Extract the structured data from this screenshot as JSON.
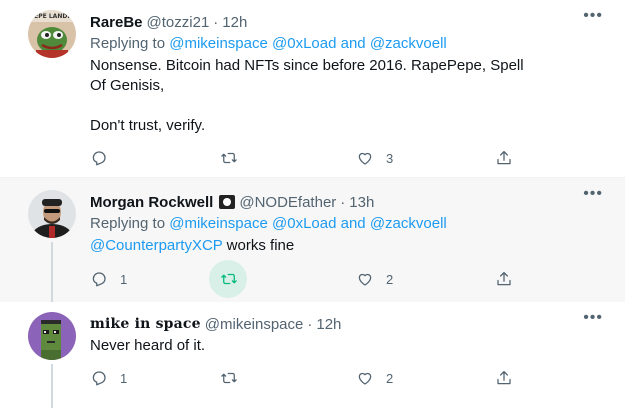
{
  "tweets": [
    {
      "name": "RareBe",
      "handle": "@tozzi21",
      "dot": "·",
      "time": "12h",
      "replying_prefix": "Replying to ",
      "replying_to": [
        "@mikeinspace",
        "@0xLoad",
        "@zackvoell"
      ],
      "replying_sep1": " ",
      "replying_and": " and ",
      "body_line1": "Nonsense. Bitcoin had NFTs since before 2016. RapePepe, Spell Of Genisis,",
      "body_line2": "Don't trust, verify.",
      "reply_count": "",
      "retweet_count": "",
      "like_count": "3",
      "avatar_label": "PEPE LANDIA"
    },
    {
      "name": "Morgan Rockwell",
      "handle": "@NODEfather",
      "dot": "·",
      "time": "13h",
      "replying_prefix": "Replying to ",
      "replying_to": [
        "@mikeinspace",
        "@0xLoad",
        "@zackvoell"
      ],
      "replying_sep1": " ",
      "replying_and": " and ",
      "body_mention": "@CounterpartyXCP",
      "body_rest": " works fine",
      "reply_count": "1",
      "retweet_count": "",
      "like_count": "2"
    },
    {
      "name": "mike in space",
      "handle": "@mikeinspace",
      "dot": "·",
      "time": "12h",
      "body": "Never heard of it.",
      "reply_count": "1",
      "retweet_count": "",
      "like_count": "2"
    }
  ],
  "icons": {
    "more": "more-icon",
    "reply": "reply-icon",
    "retweet": "retweet-icon",
    "like": "heart-icon",
    "share": "share-icon",
    "badge": "pirate-flag-icon"
  },
  "colors": {
    "link": "#1d9bf0",
    "muted": "#536471",
    "retweet_active": "#00ba7c",
    "thread_line": "#cfd9de"
  },
  "more_glyph": "•••"
}
